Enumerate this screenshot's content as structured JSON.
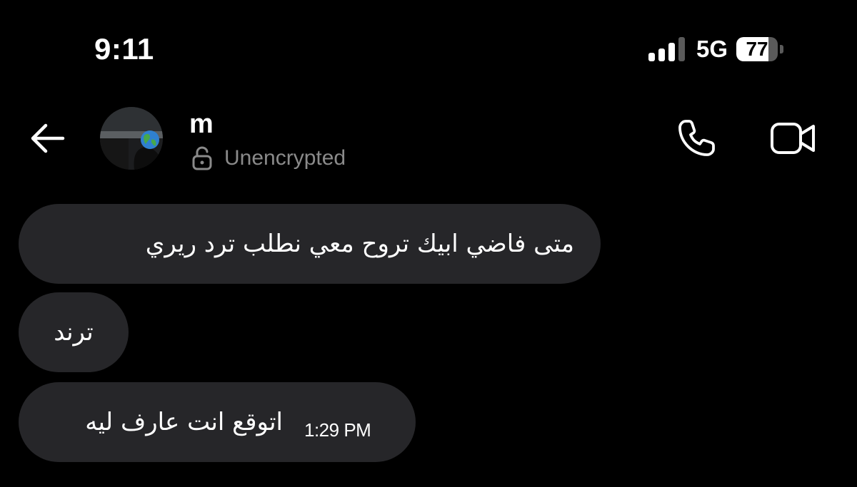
{
  "status_bar": {
    "time": "9:11",
    "network": "5G",
    "battery_percent": "77",
    "battery_level": 0.77,
    "signal_bars_active": 3,
    "signal_bars_total": 4
  },
  "header": {
    "back_icon": "arrow-left-icon",
    "contact_name": "m",
    "encryption_icon": "unlocked-padlock-icon",
    "encryption_label": "Unencrypted",
    "call_icon": "phone-icon",
    "video_icon": "video-camera-icon"
  },
  "messages": [
    {
      "text": "متى فاضي ابيك تروح معي نطلب ترد ريري",
      "time": ""
    },
    {
      "text": "ترند",
      "time": ""
    },
    {
      "text": "اتوقع انت عارف ليه",
      "time": "1:29 PM"
    }
  ],
  "colors": {
    "background": "#000000",
    "bubble": "#262629",
    "secondary_text": "#8a8a8a",
    "text": "#ffffff"
  }
}
